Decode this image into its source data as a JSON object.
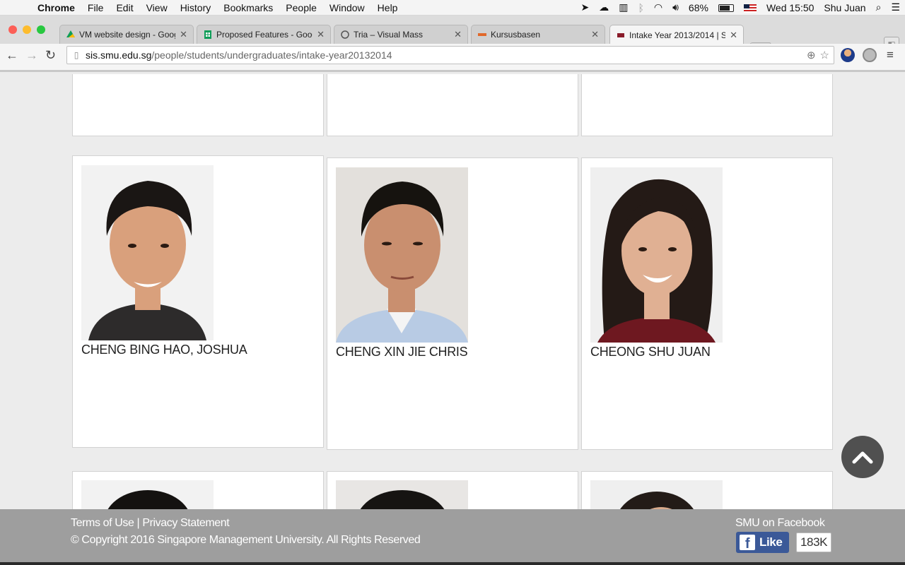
{
  "menubar": {
    "app": "Chrome",
    "items": [
      "File",
      "Edit",
      "View",
      "History",
      "Bookmarks",
      "People",
      "Window",
      "Help"
    ],
    "battery": "68%",
    "clock": "Wed 15:50",
    "user": "Shu Juan"
  },
  "tabs": [
    {
      "title": "VM website design - Goog",
      "favicon_color": "#0f9d58"
    },
    {
      "title": "Proposed Features - Goog",
      "favicon_color": "#0f9d58"
    },
    {
      "title": "Tria – Visual Mass",
      "favicon_color": "#555555"
    },
    {
      "title": "Kursusbasen",
      "favicon_color": "#e0682a"
    },
    {
      "title": "Intake Year 2013/2014 | S",
      "favicon_color": "#8a1c2a"
    }
  ],
  "address": {
    "host": "sis.smu.edu.sg",
    "path": "/people/students/undergraduates/intake-year20132014"
  },
  "students": [
    {
      "name": "CHENG BING HAO, JOSHUA",
      "bg": "#f0f0f0",
      "shirt": "#2d2b2b",
      "skin": "#d9a07c",
      "hair": "#1a1614"
    },
    {
      "name": "CHENG XIN JIE CHRIS",
      "bg": "#e3e0dc",
      "shirt": "#b8cbe4",
      "skin": "#c98f6f",
      "hair": "#16130f"
    },
    {
      "name": "CHEONG SHU JUAN",
      "bg": "#efefef",
      "shirt": "#6e1820",
      "skin": "#e0b093",
      "hair": "#241a16"
    }
  ],
  "footer": {
    "terms": "Terms of Use",
    "sep": "|",
    "privacy": "Privacy Statement",
    "copyright": "© Copyright 2016 Singapore Management University. All Rights Reserved",
    "fb_heading": "SMU on Facebook",
    "like_label": "Like",
    "like_count": "183K"
  },
  "colors": {
    "accent": "#3b5998",
    "footer_bg": "#9e9e9e",
    "totop_bg": "#505050"
  }
}
